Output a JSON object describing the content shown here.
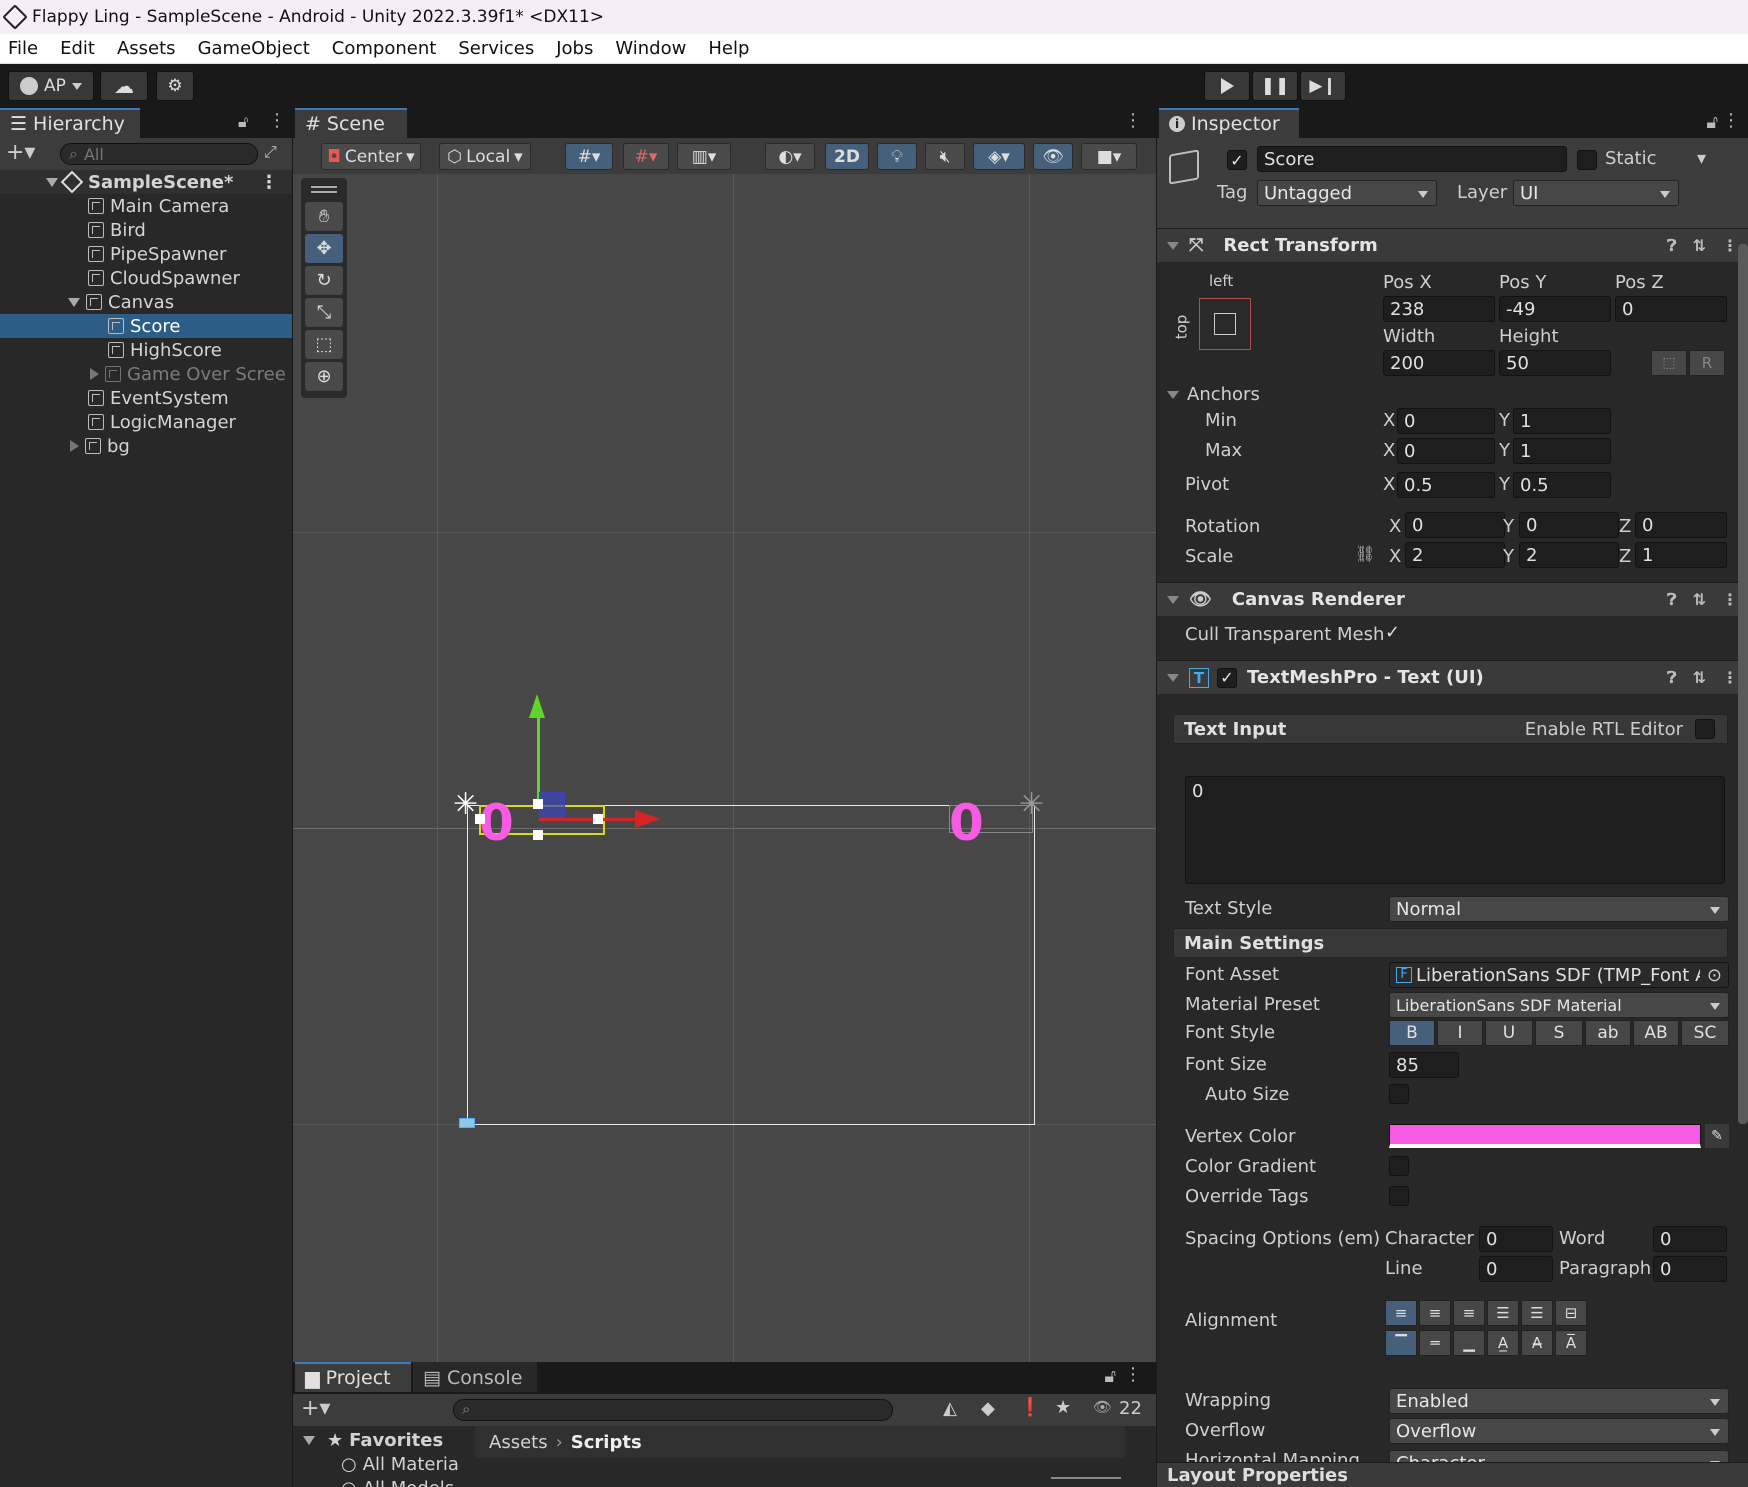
{
  "window": {
    "title": "Flappy Ling - SampleScene - Android - Unity 2022.3.39f1* <DX11>"
  },
  "menu": [
    "File",
    "Edit",
    "Assets",
    "GameObject",
    "Component",
    "Services",
    "Jobs",
    "Window",
    "Help"
  ],
  "toolbar": {
    "account": "AP"
  },
  "hierarchy": {
    "tab": "Hierarchy",
    "search_placeholder": "All",
    "scene": "SampleScene*",
    "items": [
      {
        "label": "Main Camera"
      },
      {
        "label": "Bird"
      },
      {
        "label": "PipeSpawner"
      },
      {
        "label": "CloudSpawner"
      },
      {
        "label": "Canvas"
      },
      {
        "label": "Score"
      },
      {
        "label": "HighScore"
      },
      {
        "label": "Game Over Scree"
      },
      {
        "label": "EventSystem"
      },
      {
        "label": "LogicManager"
      },
      {
        "label": "bg"
      }
    ]
  },
  "scene": {
    "tab": "Scene",
    "pivot_mode": "Center",
    "space_mode": "Local",
    "mode_2d": "2D",
    "score_left": "0",
    "score_right": "0"
  },
  "project": {
    "tab_project": "Project",
    "tab_console": "Console",
    "favorites": "Favorites",
    "fav_items": [
      "All Materia",
      "All Models"
    ],
    "breadcrumb_root": "Assets",
    "breadcrumb_current": "Scripts",
    "hidden_count": "22"
  },
  "inspector": {
    "tab": "Inspector",
    "object_name": "Score",
    "static_label": "Static",
    "tag_label": "Tag",
    "tag_value": "Untagged",
    "layer_label": "Layer",
    "layer_value": "UI",
    "rect": {
      "title": "Rect Transform",
      "anchor_h": "left",
      "anchor_v": "top",
      "posx_label": "Pos X",
      "posx": "238",
      "posy_label": "Pos Y",
      "posy": "-49",
      "posz_label": "Pos Z",
      "posz": "0",
      "width_label": "Width",
      "width": "200",
      "height_label": "Height",
      "height": "50",
      "anchors_label": "Anchors",
      "min_label": "Min",
      "min_x": "0",
      "min_y": "1",
      "max_label": "Max",
      "max_x": "0",
      "max_y": "1",
      "pivot_label": "Pivot",
      "pivot_x": "0.5",
      "pivot_y": "0.5",
      "rotation_label": "Rotation",
      "rot_x": "0",
      "rot_y": "0",
      "rot_z": "0",
      "scale_label": "Scale",
      "scale_x": "2",
      "scale_y": "2",
      "scale_z": "1",
      "x": "X",
      "y": "Y",
      "z": "Z",
      "btn_r": "R"
    },
    "canvas_renderer": {
      "title": "Canvas Renderer",
      "cull_label": "Cull Transparent Mesh"
    },
    "tmp": {
      "title": "TextMeshPro - Text (UI)",
      "text_input_label": "Text Input",
      "rtl_label": "Enable RTL Editor",
      "text_value": "0",
      "text_style_label": "Text Style",
      "text_style": "Normal",
      "main_settings": "Main Settings",
      "font_asset_label": "Font Asset",
      "font_asset": "LiberationSans SDF (TMP_Font A",
      "material_label": "Material Preset",
      "material": "LiberationSans SDF Material",
      "font_style_label": "Font Style",
      "font_styles": [
        "B",
        "I",
        "U",
        "S",
        "ab",
        "AB",
        "SC"
      ],
      "font_size_label": "Font Size",
      "font_size": "85",
      "auto_size_label": "Auto Size",
      "vertex_color_label": "Vertex Color",
      "vertex_color": "#f75ae3",
      "color_gradient_label": "Color Gradient",
      "override_tags_label": "Override Tags",
      "spacing_label": "Spacing Options (em)",
      "character_label": "Character",
      "character": "0",
      "word_label": "Word",
      "word": "0",
      "line_label": "Line",
      "line": "0",
      "paragraph_label": "Paragraph",
      "paragraph": "0",
      "alignment_label": "Alignment",
      "wrapping_label": "Wrapping",
      "wrapping": "Enabled",
      "overflow_label": "Overflow",
      "overflow": "Overflow",
      "hmapping_label": "Horizontal Mapping",
      "hmapping": "Character"
    },
    "layout_properties": "Layout Properties"
  },
  "colors": {
    "accent": "#3a79bb",
    "selection": "#2c5d87",
    "score_text": "#f75ae3"
  }
}
